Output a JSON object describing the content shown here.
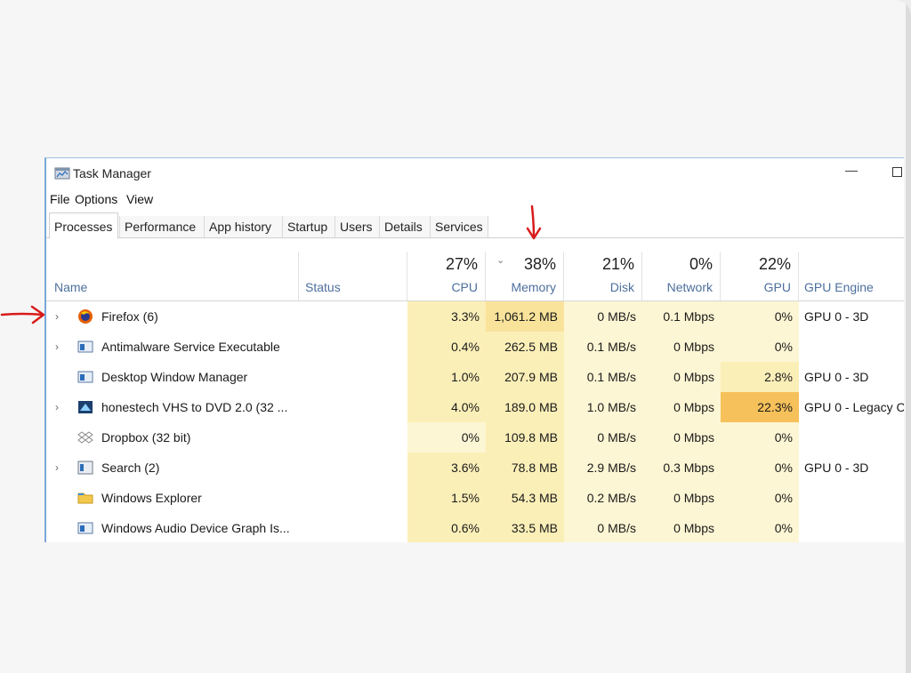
{
  "window": {
    "title": "Task Manager"
  },
  "menu": [
    "File",
    "Options",
    "View"
  ],
  "tabs": [
    {
      "label": "Processes",
      "active": true
    },
    {
      "label": "Performance",
      "active": false
    },
    {
      "label": "App history",
      "active": false
    },
    {
      "label": "Startup",
      "active": false
    },
    {
      "label": "Users",
      "active": false
    },
    {
      "label": "Details",
      "active": false
    },
    {
      "label": "Services",
      "active": false
    }
  ],
  "columns": {
    "name": {
      "label": "Name"
    },
    "status": {
      "label": "Status"
    },
    "cpu": {
      "label": "CPU",
      "pct": "27%"
    },
    "memory": {
      "label": "Memory",
      "pct": "38%",
      "sorted": true
    },
    "disk": {
      "label": "Disk",
      "pct": "21%"
    },
    "network": {
      "label": "Network",
      "pct": "0%"
    },
    "gpu": {
      "label": "GPU",
      "pct": "22%"
    },
    "gpu_engine": {
      "label": "GPU Engine"
    }
  },
  "processes": [
    {
      "name": "Firefox (6)",
      "icon": "firefox-icon",
      "expandable": true,
      "cpu": "3.3%",
      "memory": "1,061.2 MB",
      "disk": "0 MB/s",
      "network": "0.1 Mbps",
      "gpu": "0%",
      "gpu_engine": "GPU 0 - 3D"
    },
    {
      "name": "Antimalware Service Executable",
      "icon": "service-window-icon",
      "expandable": true,
      "cpu": "0.4%",
      "memory": "262.5 MB",
      "disk": "0.1 MB/s",
      "network": "0 Mbps",
      "gpu": "0%",
      "gpu_engine": ""
    },
    {
      "name": "Desktop Window Manager",
      "icon": "service-window-icon",
      "expandable": false,
      "cpu": "1.0%",
      "memory": "207.9 MB",
      "disk": "0.1 MB/s",
      "network": "0 Mbps",
      "gpu": "2.8%",
      "gpu_engine": "GPU 0 - 3D"
    },
    {
      "name": "honestech VHS to DVD 2.0 (32 ...",
      "icon": "honestech-app-icon",
      "expandable": true,
      "cpu": "4.0%",
      "memory": "189.0 MB",
      "disk": "1.0 MB/s",
      "network": "0 Mbps",
      "gpu": "22.3%",
      "gpu_engine": "GPU 0 - Legacy C"
    },
    {
      "name": "Dropbox (32 bit)",
      "icon": "dropbox-icon",
      "expandable": false,
      "cpu": "0%",
      "memory": "109.8 MB",
      "disk": "0 MB/s",
      "network": "0 Mbps",
      "gpu": "0%",
      "gpu_engine": ""
    },
    {
      "name": "Search (2)",
      "icon": "search-app-icon",
      "expandable": true,
      "cpu": "3.6%",
      "memory": "78.8 MB",
      "disk": "2.9 MB/s",
      "network": "0.3 Mbps",
      "gpu": "0%",
      "gpu_engine": "GPU 0 - 3D"
    },
    {
      "name": "Windows Explorer",
      "icon": "folder-icon",
      "expandable": false,
      "cpu": "1.5%",
      "memory": "54.3 MB",
      "disk": "0.2 MB/s",
      "network": "0 Mbps",
      "gpu": "0%",
      "gpu_engine": ""
    },
    {
      "name": "Windows Audio Device Graph Is...",
      "icon": "service-window-icon",
      "expandable": false,
      "cpu": "0.6%",
      "memory": "33.5 MB",
      "disk": "0 MB/s",
      "network": "0 Mbps",
      "gpu": "0%",
      "gpu_engine": ""
    }
  ],
  "heat_colors": {
    "light": "#fdf6d4",
    "low": "#fbefb8",
    "mid": "#f9e39a",
    "high": "#f6c15a"
  }
}
